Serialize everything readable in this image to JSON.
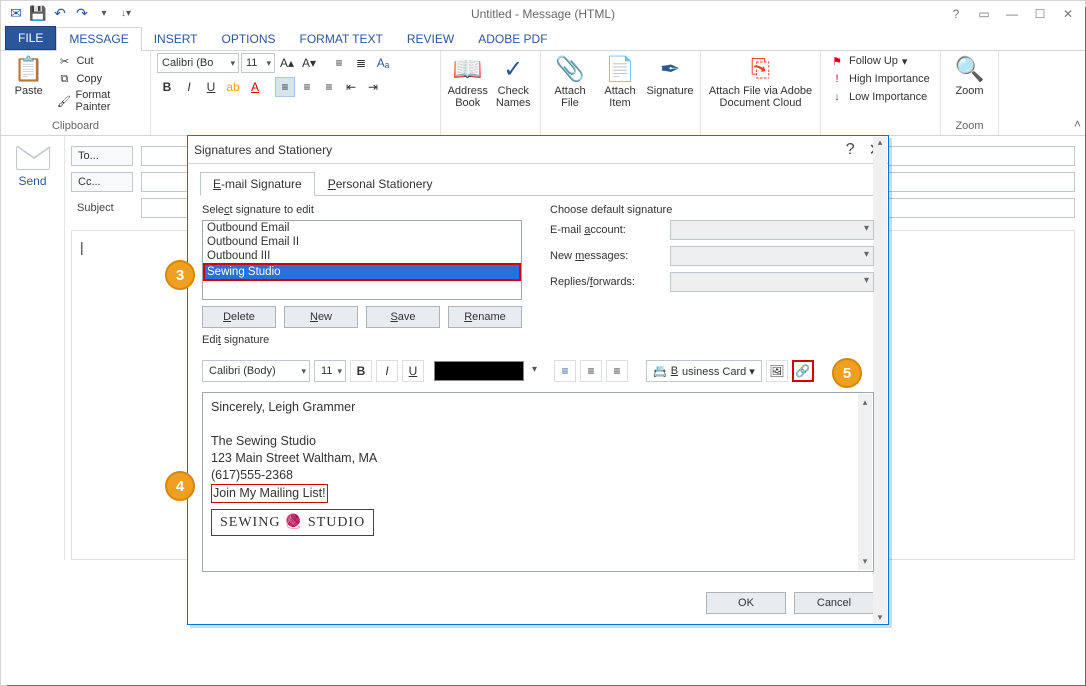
{
  "window": {
    "title": "Untitled - Message (HTML)"
  },
  "qat": {
    "items": [
      "save",
      "undo",
      "redo"
    ]
  },
  "tabs": {
    "file": "FILE",
    "message": "MESSAGE",
    "insert": "INSERT",
    "options": "OPTIONS",
    "format_text": "FORMAT TEXT",
    "review": "REVIEW",
    "adobe_pdf": "ADOBE PDF"
  },
  "ribbon": {
    "clipboard": {
      "label": "Clipboard",
      "paste": "Paste",
      "cut": "Cut",
      "copy": "Copy",
      "format_painter": "Format Painter"
    },
    "font": {
      "font_name": "Calibri (Bo",
      "font_size": "11"
    },
    "names": {
      "address_book": "Address Book",
      "check_names": "Check Names"
    },
    "include": {
      "attach_file": "Attach File",
      "attach_item": "Attach Item",
      "signature": "Signature"
    },
    "adobe": {
      "attach_cloud": "Attach File via Adobe Document Cloud"
    },
    "tags": {
      "follow_up": "Follow Up",
      "high": "High Importance",
      "low": "Low Importance"
    },
    "zoom": {
      "label": "Zoom",
      "btn": "Zoom"
    }
  },
  "compose": {
    "send": "Send",
    "to": "To...",
    "cc": "Cc...",
    "subject": "Subject"
  },
  "dialog": {
    "title": "Signatures and Stationery",
    "tab_email": "E-mail Signature",
    "tab_stationery": "Personal Stationery",
    "select_label": "Select signature to edit",
    "signatures": [
      "Outbound Email",
      "Outbound Email II",
      "Outbound III",
      "Sewing Studio"
    ],
    "selected_index": 3,
    "btn_delete": "Delete",
    "btn_new": "New",
    "btn_save": "Save",
    "btn_rename": "Rename",
    "defaults_label": "Choose default signature",
    "email_account": "E-mail account:",
    "new_messages": "New messages:",
    "replies_forwards": "Replies/forwards:",
    "edit_label": "Edit signature",
    "toolbar": {
      "font": "Calibri (Body)",
      "size": "11",
      "business_card": "Business Card"
    },
    "signature_body": {
      "line1": "Sincerely,   Leigh Grammer",
      "line2": "",
      "line3": "The Sewing Studio",
      "line4": "123 Main Street Waltham, MA",
      "line5": "(617)555-2368",
      "line6": "Join My Mailing List!",
      "logo_text": "SEWING 🧶 STUDIO"
    },
    "ok": "OK",
    "cancel": "Cancel"
  },
  "callouts": {
    "c3": "3",
    "c4": "4",
    "c5": "5"
  }
}
